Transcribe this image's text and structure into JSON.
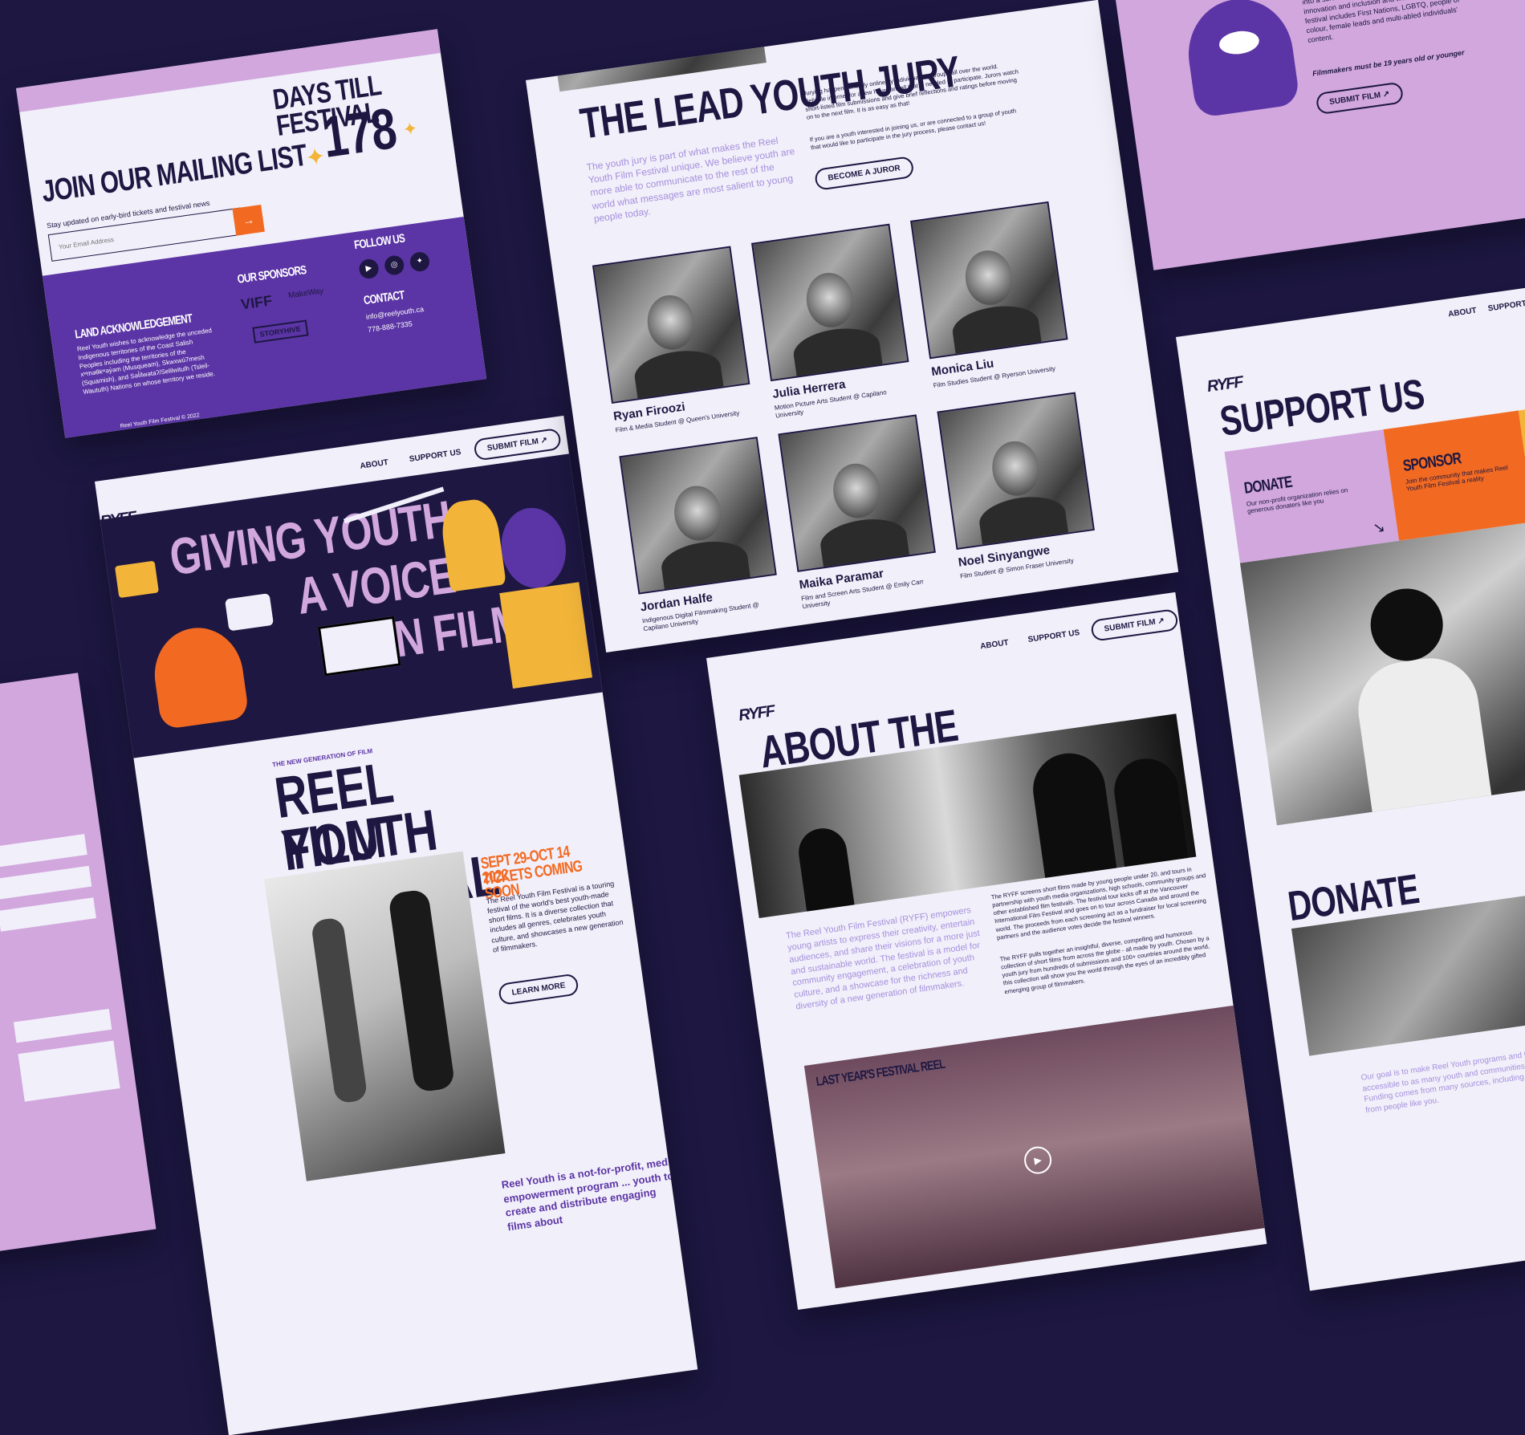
{
  "mailing": {
    "days_title": "DAYS TILL FESTIVAL",
    "days_count": "178",
    "join_title": "JOIN OUR MAILING LIST",
    "join_sub": "Stay updated on early-bird tickets and festival news",
    "email_placeholder": "Your Email Address",
    "submit_arrow": "→",
    "land_title": "LAND ACKNOWLEDGEMENT",
    "land_text": "Reel Youth wishes to acknowledge the unceded Indigenous territories of the Coast Salish Peoples including the territories of the xʷməθkʷəy̓əm (Musqueam), Skwxwú7mesh (Squamish), and Səl̓ílwətaʔ/Selilwitulh (Tsleil-Waututh) Nations on whose territory we reside.",
    "sponsors_title": "OUR SPONSORS",
    "sponsors": [
      "VIFF",
      "MakeWay",
      "STORYHIVE"
    ],
    "follow_title": "FOLLOW US",
    "social_icons": [
      "youtube-icon",
      "instagram-icon",
      "twitter-icon"
    ],
    "contact_title": "CONTACT",
    "contact_email": "info@reelyouth.ca",
    "contact_phone": "778-888-7335",
    "copyright": "Reel Youth Film Festival © 2022"
  },
  "home": {
    "nav": [
      "ABOUT",
      "SUPPORT US"
    ],
    "submit": "SUBMIT FILM ↗",
    "logo": "RYFF",
    "hero_lines": [
      "GIVING YOUTH",
      "A VOICE",
      "IN FILM"
    ],
    "kicker": "THE NEW GENERATION OF FILM",
    "title_lines": [
      "REEL YOUTH",
      "FILM FESTIVAL"
    ],
    "dates": "SEPT 29-OCT 14 2022",
    "tickets": "TICKETS COMING SOON",
    "blurb": "The Reel Youth Film Festival is a touring festival of the world's best youth-made short films. It is a diverse collection that includes all genres, celebrates youth culture, and showcases a new generation of filmmakers.",
    "learn_more": "LEARN MORE",
    "tagline": "Reel Youth is a not-for-profit, media empowerment program ... youth to create and distribute engaging films about"
  },
  "jury": {
    "title": "THE LEAD YOUTH JURY",
    "intro": "The youth jury is part of what makes the Reel Youth Film Festival unique. We believe youth are more able to communicate to the rest of the world what messages are most salient to young people today.",
    "detail": "Jurying happens entirely online by individuals or groups all over the world. Reliable internet for a few hours are all that is needed to participate. Jurors watch short-listed film submissions and give brief reflections and ratings before moving on to the next film. It is as easy as that!",
    "detail2": "If you are a youth interested in joining us, or are connected to a group of youth that would like to participate in the jury process, please contact us!",
    "cta": "BECOME A JUROR",
    "members": [
      {
        "name": "Ryan Firoozi",
        "role": "Film & Media Student @ Queen's University"
      },
      {
        "name": "Julia Herrera",
        "role": "Motion Picture Arts Student @ Capilano University"
      },
      {
        "name": "Monica Liu",
        "role": "Film Studies Student @ Ryerson University"
      },
      {
        "name": "Jordan Halfe",
        "role": "Indigenous Digital Filmmaking Student @ Capilano University"
      },
      {
        "name": "Maika Paramar",
        "role": "Film and Screen Arts Student @ Emily Carr University"
      },
      {
        "name": "Noel Sinyangwe",
        "role": "Film Student @ Simon Fraser University"
      }
    ]
  },
  "about": {
    "nav": [
      "ABOUT",
      "SUPPORT US"
    ],
    "submit": "SUBMIT FILM ↗",
    "logo": "RYFF",
    "title": "ABOUT THE FESTIVAL",
    "lead": "The Reel Youth Film Festival (RYFF) empowers young artists to express their creativity, entertain audiences, and share their visions for a more just and sustainable world. The festival is a model for community engagement, a celebration of youth culture, and a showcase for the richness and diversity of a new generation of filmmakers.",
    "col1": "The RYFF screens short films made by young people under 20, and tours in partnership with youth media organizations, high schools, community groups and other established film festivals. The festival tour kicks off at the Vancouver International Film Festival and goes on to tour across Canada and around the world. The proceeds from each screening act as a fundraiser for local screening partners and the audience votes decide the festival winners.",
    "col2": "The RYFF pulls together an insightful, diverse, compelling and humorous collection of short films from across the globe - all made by youth. Chosen by a youth jury from hundreds of submissions and 100+ countries around the world, this collection will show you the world through the eyes of an incredibly gifted emerging group of filmmakers.",
    "reel_title": "LAST YEAR'S FESTIVAL REEL"
  },
  "submit_card": {
    "text": "The films that toured are all chosen by a youth jury. They rate all entries based on entertainment value, production value and the message portrayed. The top rated films are then curated into a screening of 80 minutes. We value innovation and inclusion and work to ensure the festival includes First Nations, LGBTQ, people of colour, female leads and multi-abled individuals' content.",
    "note": "Filmmakers must be 19 years old or younger",
    "cta": "SUBMIT FILM ↗"
  },
  "support": {
    "nav": [
      "ABOUT",
      "SUPPORT"
    ],
    "logo": "RYFF",
    "title": "SUPPORT US",
    "donate_title": "DONATE",
    "donate_text": "Our non-profit organization relies on generous donaters like you",
    "sponsor_title": "SPONSOR",
    "sponsor_text": "Join the community that makes Reel Youth Film Festival a reality",
    "donate_heading": "DONATE",
    "donate_body": "Our goal is to make Reel Youth programs and the festival accessible to as many youth and communities as possible. Funding comes from many sources, including donations from people like you."
  },
  "colors": {
    "navy": "#1d1742",
    "purple": "#5b35a5",
    "lilac": "#d1a7de",
    "orange": "#f26a22",
    "yellow": "#f2b53a",
    "light": "#f1eff9"
  }
}
